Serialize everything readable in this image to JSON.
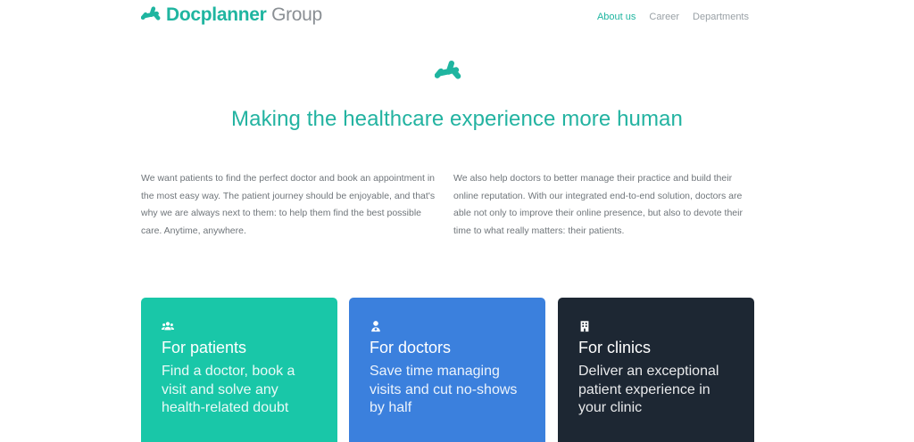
{
  "header": {
    "logo": {
      "name": "Docplanner",
      "suffix": " Group"
    },
    "nav": [
      {
        "label": "About us",
        "active": true
      },
      {
        "label": "Career",
        "active": false
      },
      {
        "label": "Departments",
        "active": false
      }
    ]
  },
  "hero": {
    "title": "Making the healthcare experience more human",
    "intro_left": "We want patients to find the perfect doctor and book an appointment in the most easy way. The patient journey should be enjoyable, and that's why we are always next to them: to help them find the best possible care. Anytime, anywhere.",
    "intro_right": "We also help doctors to better manage their practice and build their online reputation. With our integrated end-to-end solution, doctors are able not only to improve their online presence, but also to devote their time to what really matters: their patients."
  },
  "cards": [
    {
      "icon": "users-icon",
      "title": "For patients",
      "text": "Find a doctor, book a visit and solve any health-related doubt",
      "color": "#19c7a8"
    },
    {
      "icon": "doctor-icon",
      "title": "For doctors",
      "text": "Save time managing visits and cut no-shows by half",
      "color": "#3b80dd"
    },
    {
      "icon": "building-icon",
      "title": "For clinics",
      "text": "Deliver an exceptional patient experience in your clinic",
      "color": "#1d2733"
    }
  ],
  "colors": {
    "brand": "#1fb5a0",
    "text_muted": "#6f757a"
  }
}
